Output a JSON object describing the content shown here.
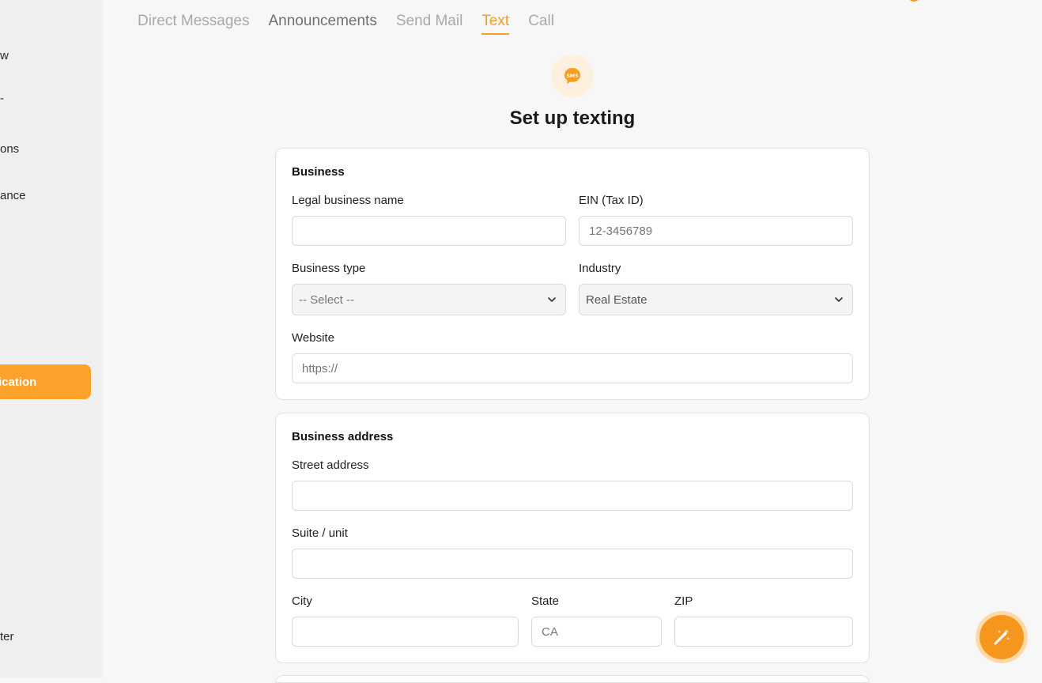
{
  "sidebar": {
    "items": [
      {
        "label": "w"
      },
      {
        "label": "-"
      },
      {
        "label": "ons"
      },
      {
        "label": "ance"
      },
      {
        "label": "ication",
        "active": true
      },
      {
        "label": "ter"
      }
    ]
  },
  "tabs": [
    {
      "label": "Direct Messages",
      "state": "inactive"
    },
    {
      "label": "Announcements",
      "state": "inactive-dark"
    },
    {
      "label": "Send Mail",
      "state": "inactive"
    },
    {
      "label": "Text",
      "state": "active"
    },
    {
      "label": "Call",
      "state": "inactive"
    }
  ],
  "header": {
    "badge_text": "SMS",
    "title": "Set up texting"
  },
  "business": {
    "title": "Business",
    "legal_name": {
      "label": "Legal business name",
      "value": "",
      "placeholder": ""
    },
    "ein": {
      "label": "EIN (Tax ID)",
      "value": "",
      "placeholder": "12-3456789"
    },
    "business_type": {
      "label": "Business type",
      "value": "-- Select --"
    },
    "industry": {
      "label": "Industry",
      "value": "Real Estate"
    },
    "website": {
      "label": "Website",
      "value": "",
      "placeholder": "https://"
    }
  },
  "address": {
    "title": "Business address",
    "street": {
      "label": "Street address",
      "value": ""
    },
    "suite": {
      "label": "Suite / unit",
      "value": ""
    },
    "city": {
      "label": "City",
      "value": ""
    },
    "state": {
      "label": "State",
      "value": "",
      "placeholder": "CA"
    },
    "zip": {
      "label": "ZIP",
      "value": ""
    }
  },
  "colors": {
    "accent": "#f59e23",
    "sidebar_active": "#fca22b",
    "fab": "#f7961d"
  },
  "icons": {
    "sms": "sms-bubble-icon",
    "chevron": "chevron-down-icon",
    "fab": "magic-wand-icon"
  }
}
